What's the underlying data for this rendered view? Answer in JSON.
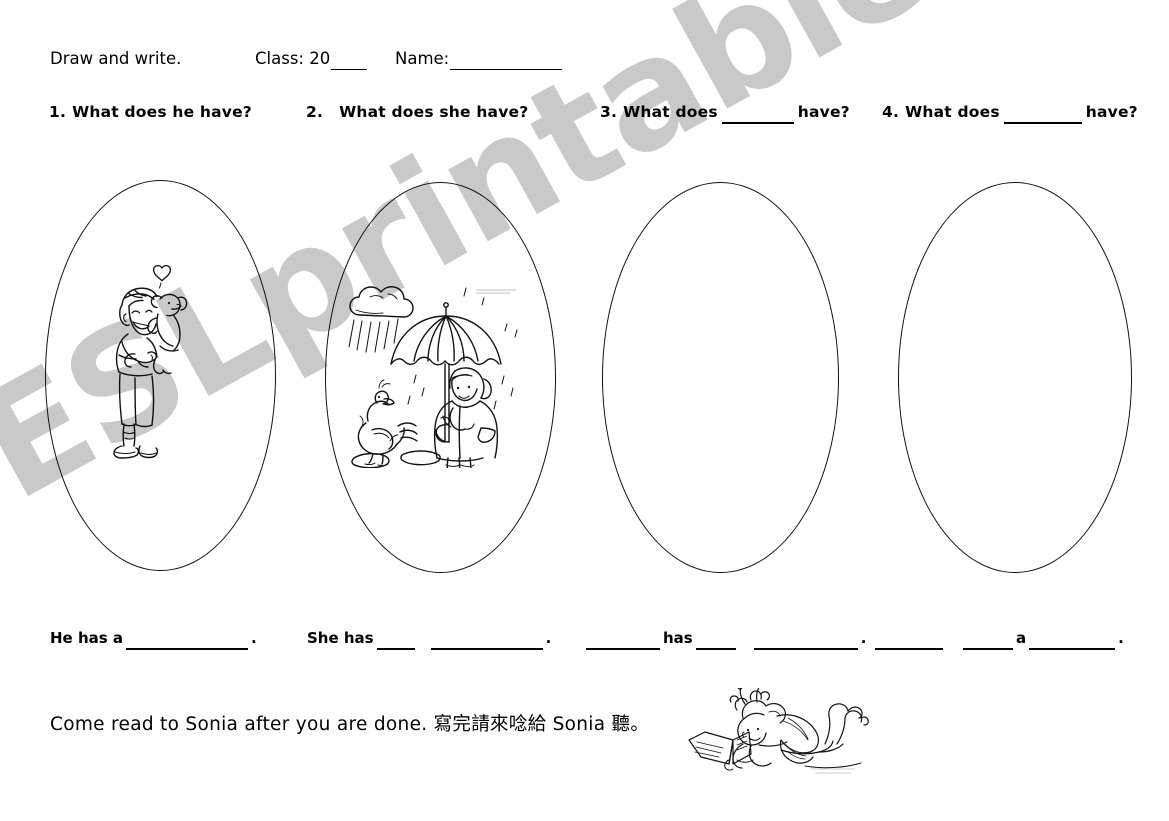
{
  "header": {
    "instruction": "Draw and write.",
    "class_label": "Class: 20",
    "name_label": "Name:"
  },
  "questions": [
    {
      "number": "1.",
      "text_before": "What does he have?",
      "text_after": "",
      "has_blank": false
    },
    {
      "number": "2.",
      "text_before": "What does she have?",
      "text_after": "",
      "has_blank": false
    },
    {
      "number": "3.",
      "text_before": "What does",
      "text_after": "have?",
      "has_blank": true
    },
    {
      "number": "4.",
      "text_before": "What does",
      "text_after": "have?",
      "has_blank": true
    }
  ],
  "panels": [
    {
      "id": "oval-1",
      "illustration": "boy-hugging-puppy-with-heart",
      "filled": true
    },
    {
      "id": "oval-2",
      "illustration": "girl-with-umbrella-duck-rain-cloud",
      "filled": true
    },
    {
      "id": "oval-3",
      "illustration": "",
      "filled": false
    },
    {
      "id": "oval-4",
      "illustration": "",
      "filled": false
    }
  ],
  "answers": [
    {
      "prefix": "He has a",
      "mid": "",
      "suffix": "",
      "period": "."
    },
    {
      "prefix": "She has",
      "mid": "",
      "suffix": "",
      "period": "."
    },
    {
      "prefix": "",
      "mid": "has",
      "suffix": "",
      "period": "."
    },
    {
      "prefix": "",
      "mid": "a",
      "suffix": "",
      "period": "."
    }
  ],
  "footer": {
    "note": "Come read to Sonia after you are done. 寫完請來唸給 Sonia 聽。",
    "illustration": "fairy-reading-book"
  },
  "watermark": {
    "text": "ESLprintables.com",
    "color": "#c9c9c9"
  }
}
